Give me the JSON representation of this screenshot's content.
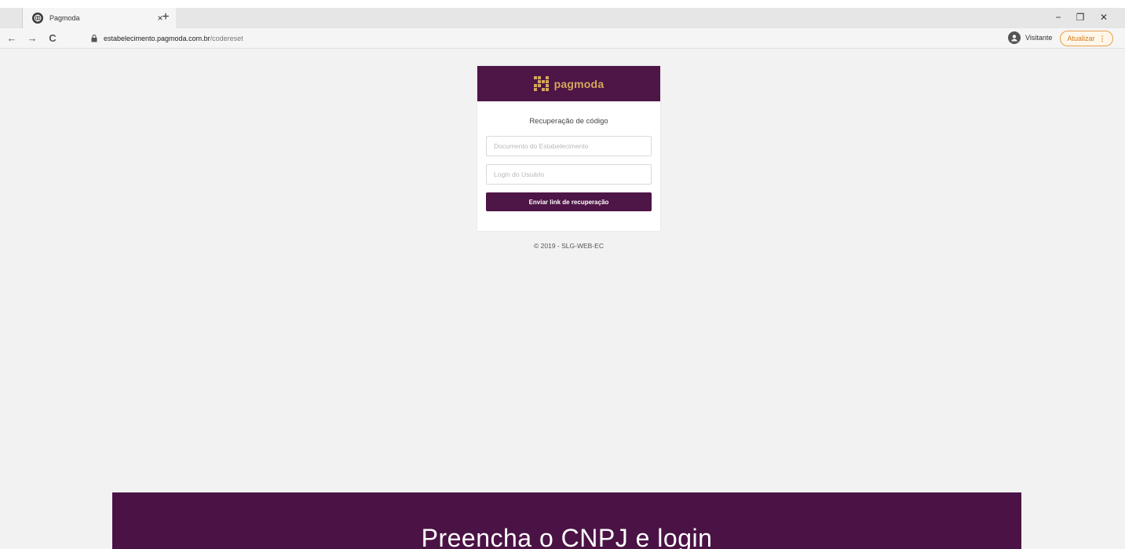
{
  "browser": {
    "tab_title": "Pagmoda",
    "tab_close": "×",
    "new_tab": "+",
    "url_host": "estabelecimento.pagmoda.com.br",
    "url_path": "/codereset",
    "profile_label": "Visitante",
    "update_label": "Atualizar",
    "update_menu": "⋮",
    "back": "←",
    "forward": "→",
    "reload": "C",
    "minimize": "−",
    "restore": "❐",
    "close": "✕"
  },
  "card": {
    "logo_text": "pagmoda",
    "title": "Recuperação de código",
    "document_placeholder": "Documento do Estabelecimento",
    "login_placeholder": "Login do Usuário",
    "submit_label": "Enviar link de recuperação"
  },
  "footer": {
    "copyright": "© 2019 - SLG-WEB-EC"
  },
  "banner": {
    "text": "Preencha o CNPJ e login"
  },
  "colors": {
    "brand": "#4e1547",
    "logo_gold": "#d6a85a",
    "update_accent": "#e8a04a"
  }
}
